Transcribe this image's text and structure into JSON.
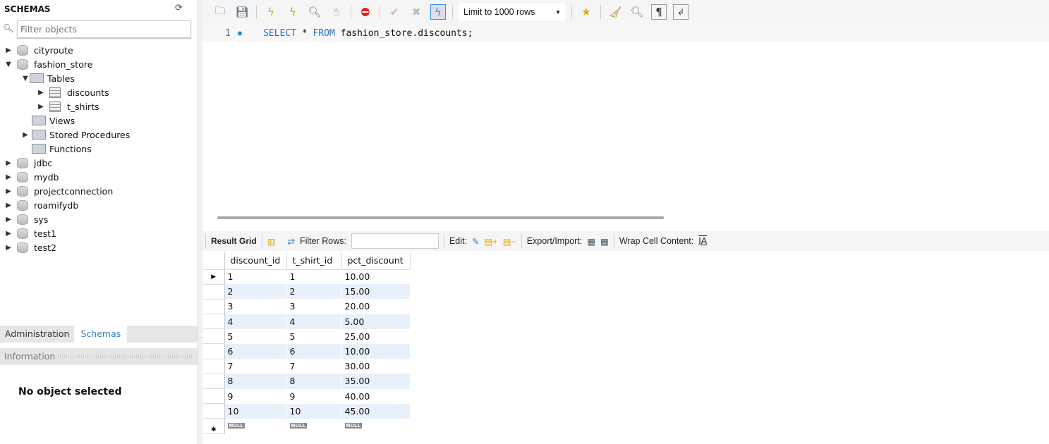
{
  "sidebar": {
    "title": "SCHEMAS",
    "filter_placeholder": "Filter objects",
    "tree": {
      "cityroute": "cityroute",
      "fashion_store": "fashion_store",
      "tables": "Tables",
      "discounts": "discounts",
      "t_shirts": "t_shirts",
      "views": "Views",
      "procs": "Stored Procedures",
      "functions": "Functions",
      "jdbc": "jdbc",
      "mydb": "mydb",
      "projectconnection": "projectconnection",
      "roamifydb": "roamifydb",
      "sys": "sys",
      "test1": "test1",
      "test2": "test2"
    },
    "tabs": [
      "Administration",
      "Schemas"
    ],
    "info_title": "Information",
    "no_object": "No object selected"
  },
  "toolbar": {
    "limit": "Limit to 1000 rows"
  },
  "editor": {
    "line": "1",
    "kw1": "SELECT",
    "mid": " * ",
    "kw2": "FROM",
    "rest": " fashion_store.discounts;"
  },
  "results": {
    "result_grid": "Result Grid",
    "filter_rows": "Filter Rows:",
    "edit": "Edit:",
    "export_import": "Export/Import:",
    "wrap": "Wrap Cell Content:",
    "columns": [
      "discount_id",
      "t_shirt_id",
      "pct_discount"
    ],
    "rows": [
      [
        "1",
        "1",
        "10.00"
      ],
      [
        "2",
        "2",
        "15.00"
      ],
      [
        "3",
        "3",
        "20.00"
      ],
      [
        "4",
        "4",
        "5.00"
      ],
      [
        "5",
        "5",
        "25.00"
      ],
      [
        "6",
        "6",
        "10.00"
      ],
      [
        "7",
        "7",
        "30.00"
      ],
      [
        "8",
        "8",
        "35.00"
      ],
      [
        "9",
        "9",
        "40.00"
      ],
      [
        "10",
        "10",
        "45.00"
      ]
    ],
    "null": "NULL"
  }
}
